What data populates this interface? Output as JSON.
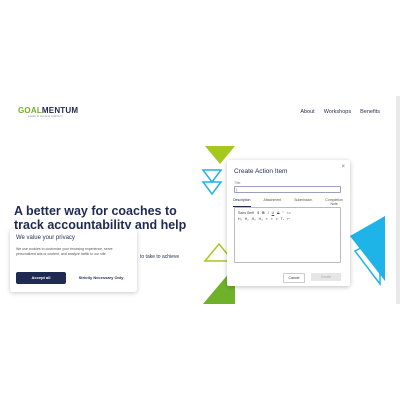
{
  "brand": {
    "name_green": "GOAL",
    "name_navy": "MENTUM",
    "tagline": "coach & student platform"
  },
  "nav": [
    "About",
    "Workshops",
    "Benefits"
  ],
  "hero": {
    "line1": "A better way for coaches to",
    "line2": "track accountability and help",
    "partial": "to take to achieve"
  },
  "modal": {
    "title": "Create Action Item",
    "close": "×",
    "title_label": "Title",
    "title_value": "|",
    "tabs": [
      {
        "l1": "Description"
      },
      {
        "l1": "Attachment"
      },
      {
        "l1": "Submission"
      },
      {
        "l1": "Completion",
        "l2": "Note"
      }
    ],
    "toolbar_row1": [
      "Sans Serif",
      "$",
      "B",
      "I",
      "U",
      "S",
      "”",
      "<>"
    ],
    "toolbar_row2": [
      "H₁",
      "H₂",
      "H₃",
      "H₄",
      "≡",
      "≡",
      "≡",
      "Tₓ",
      "↵"
    ],
    "cancel": "Cancel",
    "create": "Create"
  },
  "cookie": {
    "title": "We value your privacy",
    "text": "We use cookies to customize your browsing experience, serve personalized ads or content, and analyze traffic to our site.",
    "accept": "Accept all",
    "strict": "Strictly Necessary Only"
  },
  "colors": {
    "navy": "#1f2a52",
    "lime": "#a6c81c",
    "cyan": "#1fb4e8",
    "green": "#6fb22a"
  }
}
